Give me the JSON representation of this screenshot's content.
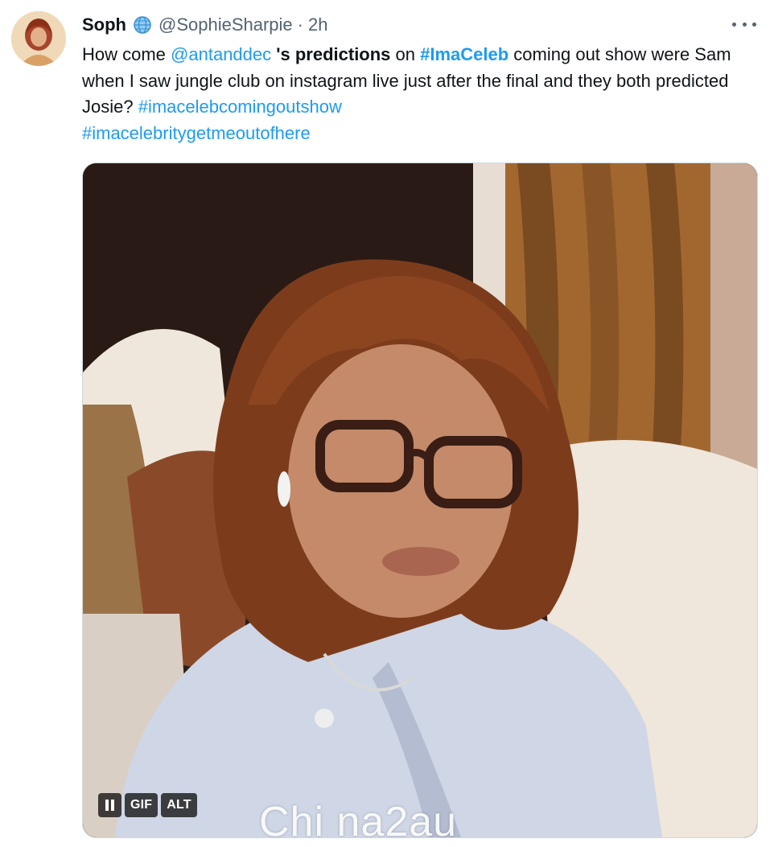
{
  "tweet": {
    "author_name": "Soph",
    "verified_icon": "globe-icon",
    "handle": "@SophieSharpie",
    "separator": "·",
    "time": "2h",
    "more_icon": "more-icon",
    "text": {
      "p1": "How come ",
      "mention": "@antanddec",
      "p2": " 's ",
      "bold": "predictions",
      "p3": " on ",
      "hashtag1": "#ImaCeleb",
      "p4": " coming out show were Sam when I saw jungle club on instagram live just after the final and they both predicted Josie? ",
      "hashtag2": "#imacelebcomingoutshow",
      "hashtag3": "#imacelebritygetmeoutofhere"
    },
    "media": {
      "badges": {
        "gif": "GIF",
        "alt": "ALT"
      }
    }
  },
  "watermark": "Chi na2au",
  "colors": {
    "link": "#1d9bf0",
    "secondary_text": "#536471",
    "primary_text": "#0f1419"
  }
}
